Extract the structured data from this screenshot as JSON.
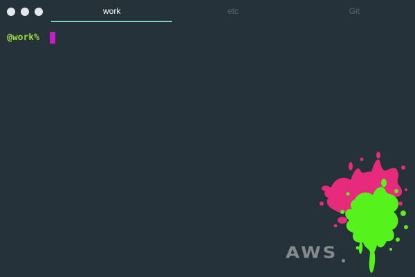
{
  "tabs": [
    {
      "label": "work",
      "active": true
    },
    {
      "label": "etc",
      "active": false
    },
    {
      "label": "Git",
      "active": false
    }
  ],
  "terminal": {
    "prompt": "@work% "
  },
  "watermark": {
    "text": "AWS"
  },
  "colors": {
    "background": "#26323a",
    "active_tab_text": "#ffffff",
    "inactive_tab_text": "#56656e",
    "tab_underline": "#7ecfc6",
    "prompt": "#9ade3d",
    "cursor": "#c21fc9",
    "splat_pink": "#e72a7c",
    "splat_green": "#55f21c"
  }
}
